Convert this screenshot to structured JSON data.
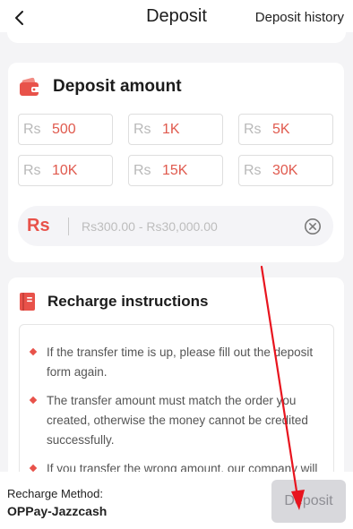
{
  "header": {
    "title": "Deposit",
    "history_label": "Deposit history"
  },
  "deposit_card": {
    "title": "Deposit amount",
    "options": [
      {
        "currency": "Rs",
        "value": "500"
      },
      {
        "currency": "Rs",
        "value": "1K"
      },
      {
        "currency": "Rs",
        "value": "5K"
      },
      {
        "currency": "Rs",
        "value": "10K"
      },
      {
        "currency": "Rs",
        "value": "15K"
      },
      {
        "currency": "Rs",
        "value": "30K"
      }
    ],
    "input": {
      "currency_label": "Rs",
      "placeholder": "Rs300.00 - Rs30,000.00",
      "value": ""
    }
  },
  "instructions_card": {
    "title": "Recharge instructions",
    "items": [
      "If the transfer time is up, please fill out the deposit form again.",
      "The transfer amount must match the order you created, otherwise the money cannot be credited successfully.",
      "If you transfer the wrong amount, our company will"
    ]
  },
  "bottom_bar": {
    "method_label": "Recharge Method:",
    "method_value": "OPPay-Jazzcash",
    "deposit_button_label": "Deposit"
  },
  "colors": {
    "accent": "#e8524a",
    "background": "#f4f4f6",
    "button_disabled": "#d8d8dc",
    "annotation": "#e8141e"
  },
  "icons": [
    "chevron-left-icon",
    "wallet-icon",
    "clear-circle-icon",
    "book-icon"
  ]
}
